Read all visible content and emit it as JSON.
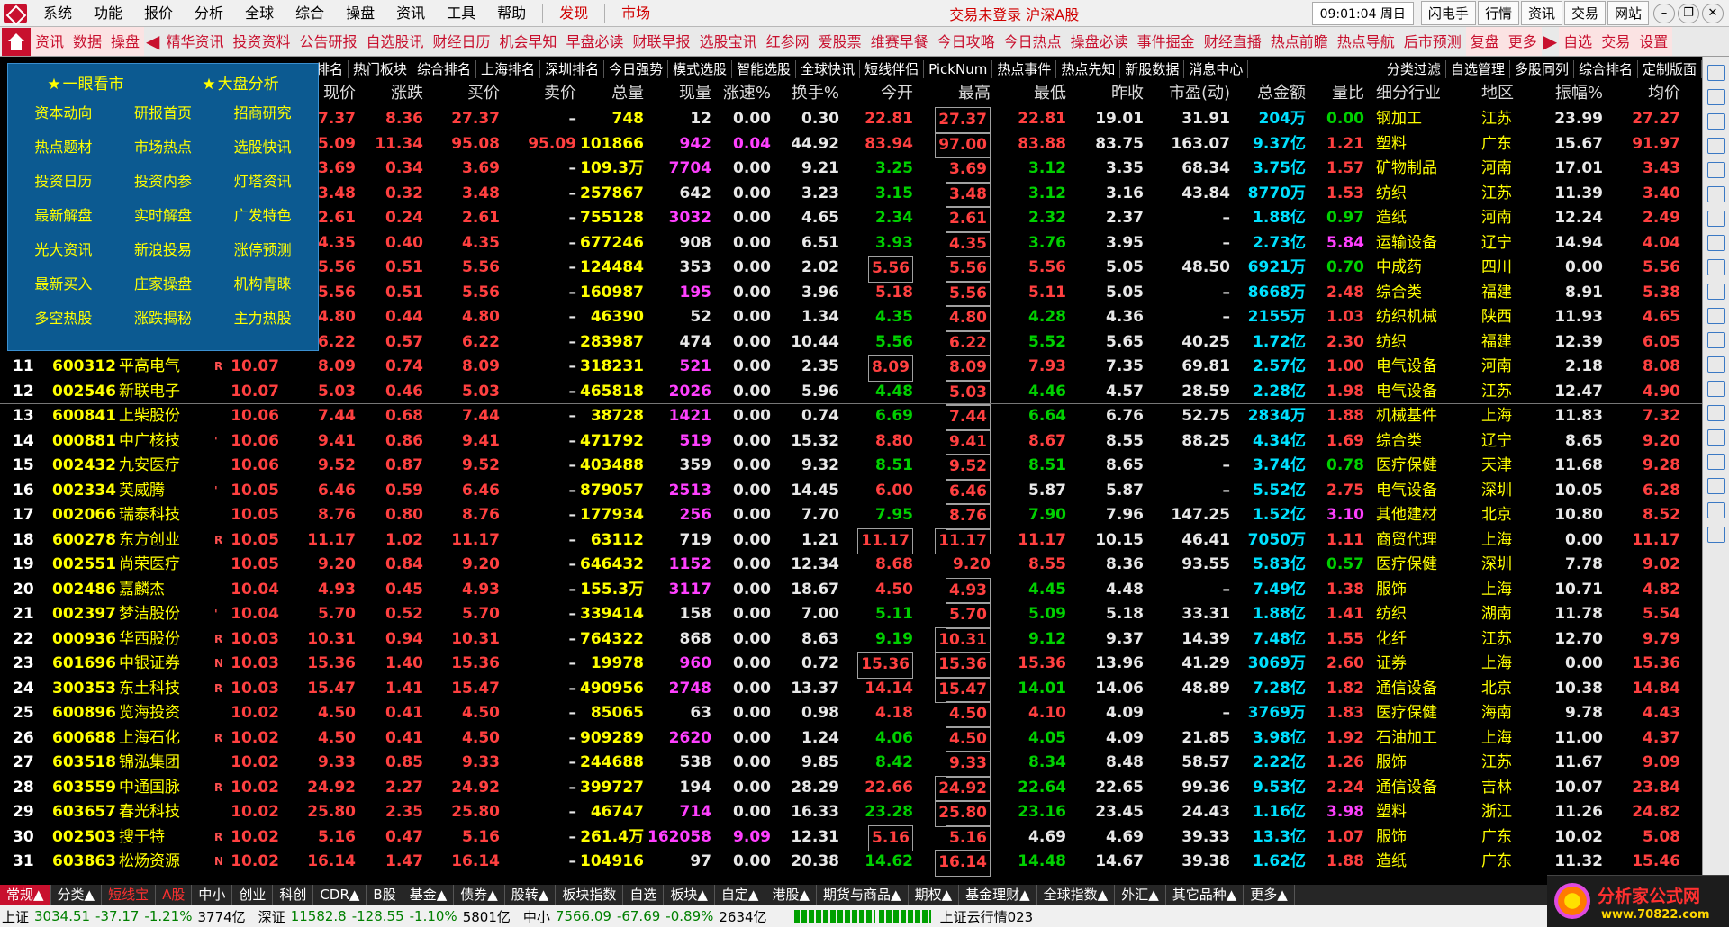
{
  "menu": [
    "系统",
    "功能",
    "报价",
    "分析",
    "全球",
    "综合",
    "操盘",
    "资讯",
    "工具",
    "帮助"
  ],
  "menu_red": [
    "发现",
    "市场"
  ],
  "status_text": "交易未登录 沪深A股",
  "clock": "09:01:04 周日",
  "right_buttons": [
    "闪电手",
    "行情",
    "资讯",
    "交易",
    "网站"
  ],
  "toolbar": [
    "资讯",
    "数据",
    "操盘",
    "精华资讯",
    "投资资料",
    "公告研报",
    "自选股讯",
    "财经日历",
    "机会早知",
    "早盘必读",
    "财联早报",
    "选股宝讯",
    "红参网",
    "爱股票",
    "维赛早餐",
    "今日攻略",
    "今日热点",
    "操盘必读",
    "事件掘金",
    "财经直播",
    "热点前瞻",
    "热点导航",
    "后市预测",
    "复盘",
    "更多",
    "自选",
    "交易",
    "设置"
  ],
  "float_menu": {
    "head": [
      "一眼看市",
      "大盘分析"
    ],
    "items": [
      "资本动向",
      "研报首页",
      "招商研究",
      "热点题材",
      "市场热点",
      "选股快讯",
      "投资日历",
      "投资内参",
      "灯塔资讯",
      "最新解盘",
      "实时解盘",
      "广发特色",
      "光大资讯",
      "新浪投易",
      "涨停预测",
      "最新买入",
      "庄家操盘",
      "机构青睐",
      "多空热股",
      "涨跌揭秘",
      "主力热股"
    ]
  },
  "column_tabs": [
    "排名",
    "热门板块",
    "综合排名",
    "上海排名",
    "深圳排名",
    "今日强势",
    "模式选股",
    "智能选股",
    "全球快讯",
    "短线伴侣",
    "PickNum",
    "热点事件",
    "热点先知",
    "新股数据",
    "消息中心",
    "分类过滤",
    "自选管理",
    "多股同列",
    "综合排名",
    "定制版面"
  ],
  "headers": [
    "现价",
    "涨跌",
    "买价",
    "卖价",
    "总量",
    "现量",
    "涨速%",
    "换手%",
    "今开",
    "最高",
    "最低",
    "昨收",
    "市盈(动)",
    "总金额",
    "量比",
    "细分行业",
    "地区",
    "振幅%",
    "均价"
  ],
  "rows": [
    {
      "no": "",
      "code": "",
      "name": "",
      "flag": "",
      "zf": "",
      "p": "27.37",
      "chg": "8.36",
      "buy": "27.37",
      "sell": "–",
      "vol": "748",
      "cur": "12",
      "spd": "0.00",
      "to": "0.30",
      "op": "22.81",
      "hi": "27.37",
      "lo": "22.81",
      "pc": "19.01",
      "pe": "31.91",
      "amt": "204万",
      "lb": "0.00",
      "ind": "钢加工",
      "reg": "江苏",
      "amp": "23.99",
      "avg": "27.27"
    },
    {
      "no": "",
      "code": "",
      "name": "",
      "flag": "",
      "zf": "",
      "p": "95.09",
      "chg": "11.34",
      "buy": "95.08",
      "sell": "95.09",
      "vol": "101866",
      "cur": "942",
      "spd": "0.04",
      "to": "44.92",
      "op": "83.94",
      "hi": "97.00",
      "lo": "83.88",
      "pc": "83.75",
      "pe": "163.07",
      "amt": "9.37亿",
      "lb": "1.21",
      "ind": "塑料",
      "reg": "广东",
      "amp": "15.67",
      "avg": "91.97"
    },
    {
      "no": "",
      "code": "",
      "name": "",
      "flag": "",
      "zf": "",
      "p": "3.69",
      "chg": "0.34",
      "buy": "3.69",
      "sell": "–",
      "vol": "109.3万",
      "cur": "7704",
      "spd": "0.00",
      "to": "9.21",
      "op": "3.25",
      "hi": "3.69",
      "lo": "3.12",
      "pc": "3.35",
      "pe": "68.34",
      "amt": "3.75亿",
      "lb": "1.57",
      "ind": "矿物制品",
      "reg": "河南",
      "amp": "17.01",
      "avg": "3.43"
    },
    {
      "no": "",
      "code": "",
      "name": "",
      "flag": "",
      "zf": "",
      "p": "3.48",
      "chg": "0.32",
      "buy": "3.48",
      "sell": "–",
      "vol": "257867",
      "cur": "642",
      "spd": "0.00",
      "to": "3.23",
      "op": "3.15",
      "hi": "3.48",
      "lo": "3.12",
      "pc": "3.16",
      "pe": "43.84",
      "amt": "8770万",
      "lb": "1.53",
      "ind": "纺织",
      "reg": "江苏",
      "amp": "11.39",
      "avg": "3.40"
    },
    {
      "no": "",
      "code": "",
      "name": "",
      "flag": "",
      "zf": "",
      "p": "2.61",
      "chg": "0.24",
      "buy": "2.61",
      "sell": "–",
      "vol": "755128",
      "cur": "3032",
      "spd": "0.00",
      "to": "4.65",
      "op": "2.34",
      "hi": "2.61",
      "lo": "2.32",
      "pc": "2.37",
      "pe": "–",
      "amt": "1.88亿",
      "lb": "0.97",
      "ind": "造纸",
      "reg": "河南",
      "amp": "12.24",
      "avg": "2.49"
    },
    {
      "no": "",
      "code": "",
      "name": "",
      "flag": "",
      "zf": "",
      "p": "4.35",
      "chg": "0.40",
      "buy": "4.35",
      "sell": "–",
      "vol": "677246",
      "cur": "908",
      "spd": "0.00",
      "to": "6.51",
      "op": "3.93",
      "hi": "4.35",
      "lo": "3.76",
      "pc": "3.95",
      "pe": "–",
      "amt": "2.73亿",
      "lb": "5.84",
      "ind": "运输设备",
      "reg": "辽宁",
      "amp": "14.94",
      "avg": "4.04"
    },
    {
      "no": "",
      "code": "",
      "name": "",
      "flag": "",
      "zf": "",
      "p": "5.56",
      "chg": "0.51",
      "buy": "5.56",
      "sell": "–",
      "vol": "124484",
      "cur": "353",
      "spd": "0.00",
      "to": "2.02",
      "op": "5.56",
      "hi": "5.56",
      "lo": "5.56",
      "pc": "5.05",
      "pe": "48.50",
      "amt": "6921万",
      "lb": "0.70",
      "ind": "中成药",
      "reg": "四川",
      "amp": "0.00",
      "avg": "5.56"
    },
    {
      "no": "",
      "code": "",
      "name": "",
      "flag": "",
      "zf": "",
      "p": "5.56",
      "chg": "0.51",
      "buy": "5.56",
      "sell": "–",
      "vol": "160987",
      "cur": "195",
      "spd": "0.00",
      "to": "3.96",
      "op": "5.18",
      "hi": "5.56",
      "lo": "5.11",
      "pc": "5.05",
      "pe": "–",
      "amt": "8668万",
      "lb": "2.48",
      "ind": "综合类",
      "reg": "福建",
      "amp": "8.91",
      "avg": "5.38"
    },
    {
      "no": "",
      "code": "",
      "name": "",
      "flag": "",
      "zf": "",
      "p": "4.80",
      "chg": "0.44",
      "buy": "4.80",
      "sell": "–",
      "vol": "46390",
      "cur": "52",
      "spd": "0.00",
      "to": "1.34",
      "op": "4.35",
      "hi": "4.80",
      "lo": "4.28",
      "pc": "4.36",
      "pe": "–",
      "amt": "2155万",
      "lb": "1.03",
      "ind": "纺织机械",
      "reg": "陕西",
      "amp": "11.93",
      "avg": "4.65"
    },
    {
      "no": "",
      "code": "",
      "name": "",
      "flag": "",
      "zf": "",
      "p": "6.22",
      "chg": "0.57",
      "buy": "6.22",
      "sell": "–",
      "vol": "283987",
      "cur": "474",
      "spd": "0.00",
      "to": "10.44",
      "op": "5.56",
      "hi": "6.22",
      "lo": "5.52",
      "pc": "5.65",
      "pe": "40.25",
      "amt": "1.72亿",
      "lb": "2.30",
      "ind": "纺织",
      "reg": "福建",
      "amp": "12.39",
      "avg": "6.05"
    },
    {
      "no": "11",
      "code": "600312",
      "name": "平高电气",
      "flag": "R",
      "zf": "10.07",
      "p": "8.09",
      "chg": "0.74",
      "buy": "8.09",
      "sell": "–",
      "vol": "318231",
      "cur": "521",
      "spd": "0.00",
      "to": "2.35",
      "op": "8.09",
      "hi": "8.09",
      "lo": "7.93",
      "pc": "7.35",
      "pe": "69.81",
      "amt": "2.57亿",
      "lb": "1.00",
      "ind": "电气设备",
      "reg": "河南",
      "amp": "2.18",
      "avg": "8.08"
    },
    {
      "no": "12",
      "code": "002546",
      "name": "新联电子",
      "flag": "",
      "zf": "10.07",
      "p": "5.03",
      "chg": "0.46",
      "buy": "5.03",
      "sell": "–",
      "vol": "465818",
      "cur": "2026",
      "spd": "0.00",
      "to": "5.96",
      "op": "4.48",
      "hi": "5.03",
      "lo": "4.46",
      "pc": "4.57",
      "pe": "28.59",
      "amt": "2.28亿",
      "lb": "1.98",
      "ind": "电气设备",
      "reg": "江苏",
      "amp": "12.47",
      "avg": "4.90"
    },
    {
      "no": "13",
      "code": "600841",
      "name": "上柴股份",
      "flag": "",
      "zf": "10.06",
      "p": "7.44",
      "chg": "0.68",
      "buy": "7.44",
      "sell": "–",
      "vol": "38728",
      "cur": "1421",
      "spd": "0.00",
      "to": "0.74",
      "op": "6.69",
      "hi": "7.44",
      "lo": "6.64",
      "pc": "6.76",
      "pe": "52.75",
      "amt": "2834万",
      "lb": "1.88",
      "ind": "机械基件",
      "reg": "上海",
      "amp": "11.83",
      "avg": "7.32"
    },
    {
      "no": "14",
      "code": "000881",
      "name": "中广核技",
      "flag": "'",
      "zf": "10.06",
      "p": "9.41",
      "chg": "0.86",
      "buy": "9.41",
      "sell": "–",
      "vol": "471792",
      "cur": "519",
      "spd": "0.00",
      "to": "15.32",
      "op": "8.80",
      "hi": "9.41",
      "lo": "8.67",
      "pc": "8.55",
      "pe": "88.25",
      "amt": "4.34亿",
      "lb": "1.69",
      "ind": "综合类",
      "reg": "辽宁",
      "amp": "8.65",
      "avg": "9.20"
    },
    {
      "no": "15",
      "code": "002432",
      "name": "九安医疗",
      "flag": "",
      "zf": "10.06",
      "p": "9.52",
      "chg": "0.87",
      "buy": "9.52",
      "sell": "–",
      "vol": "403488",
      "cur": "359",
      "spd": "0.00",
      "to": "9.32",
      "op": "8.51",
      "hi": "9.52",
      "lo": "8.51",
      "pc": "8.65",
      "pe": "–",
      "amt": "3.74亿",
      "lb": "0.78",
      "ind": "医疗保健",
      "reg": "天津",
      "amp": "11.68",
      "avg": "9.28"
    },
    {
      "no": "16",
      "code": "002334",
      "name": "英威腾",
      "flag": "'",
      "zf": "10.05",
      "p": "6.46",
      "chg": "0.59",
      "buy": "6.46",
      "sell": "–",
      "vol": "879057",
      "cur": "2513",
      "spd": "0.00",
      "to": "14.45",
      "op": "6.00",
      "hi": "6.46",
      "lo": "5.87",
      "pc": "5.87",
      "pe": "–",
      "amt": "5.52亿",
      "lb": "2.75",
      "ind": "电气设备",
      "reg": "深圳",
      "amp": "10.05",
      "avg": "6.28"
    },
    {
      "no": "17",
      "code": "002066",
      "name": "瑞泰科技",
      "flag": "",
      "zf": "10.05",
      "p": "8.76",
      "chg": "0.80",
      "buy": "8.76",
      "sell": "–",
      "vol": "177934",
      "cur": "256",
      "spd": "0.00",
      "to": "7.70",
      "op": "7.95",
      "hi": "8.76",
      "lo": "7.90",
      "pc": "7.96",
      "pe": "147.25",
      "amt": "1.52亿",
      "lb": "3.10",
      "ind": "其他建材",
      "reg": "北京",
      "amp": "10.80",
      "avg": "8.52"
    },
    {
      "no": "18",
      "code": "600278",
      "name": "东方创业",
      "flag": "R",
      "zf": "10.05",
      "p": "11.17",
      "chg": "1.02",
      "buy": "11.17",
      "sell": "–",
      "vol": "63112",
      "cur": "719",
      "spd": "0.00",
      "to": "1.21",
      "op": "11.17",
      "hi": "11.17",
      "lo": "11.17",
      "pc": "10.15",
      "pe": "46.41",
      "amt": "7050万",
      "lb": "1.11",
      "ind": "商贸代理",
      "reg": "上海",
      "amp": "0.00",
      "avg": "11.17"
    },
    {
      "no": "19",
      "code": "002551",
      "name": "尚荣医疗",
      "flag": "",
      "zf": "10.05",
      "p": "9.20",
      "chg": "0.84",
      "buy": "9.20",
      "sell": "–",
      "vol": "646432",
      "cur": "1152",
      "spd": "0.00",
      "to": "12.34",
      "op": "8.68",
      "hi": "9.20",
      "lo": "8.55",
      "pc": "8.36",
      "pe": "93.55",
      "amt": "5.83亿",
      "lb": "0.57",
      "ind": "医疗保健",
      "reg": "深圳",
      "amp": "7.78",
      "avg": "9.02"
    },
    {
      "no": "20",
      "code": "002486",
      "name": "嘉麟杰",
      "flag": "",
      "zf": "10.04",
      "p": "4.93",
      "chg": "0.45",
      "buy": "4.93",
      "sell": "–",
      "vol": "155.3万",
      "cur": "3117",
      "spd": "0.00",
      "to": "18.67",
      "op": "4.50",
      "hi": "4.93",
      "lo": "4.45",
      "pc": "4.48",
      "pe": "–",
      "amt": "7.49亿",
      "lb": "1.38",
      "ind": "服饰",
      "reg": "上海",
      "amp": "10.71",
      "avg": "4.82"
    },
    {
      "no": "21",
      "code": "002397",
      "name": "梦洁股份",
      "flag": "'",
      "zf": "10.04",
      "p": "5.70",
      "chg": "0.52",
      "buy": "5.70",
      "sell": "–",
      "vol": "339414",
      "cur": "158",
      "spd": "0.00",
      "to": "7.00",
      "op": "5.11",
      "hi": "5.70",
      "lo": "5.09",
      "pc": "5.18",
      "pe": "33.31",
      "amt": "1.88亿",
      "lb": "1.41",
      "ind": "纺织",
      "reg": "湖南",
      "amp": "11.78",
      "avg": "5.54"
    },
    {
      "no": "22",
      "code": "000936",
      "name": "华西股份",
      "flag": "R",
      "zf": "10.03",
      "p": "10.31",
      "chg": "0.94",
      "buy": "10.31",
      "sell": "–",
      "vol": "764322",
      "cur": "868",
      "spd": "0.00",
      "to": "8.63",
      "op": "9.19",
      "hi": "10.31",
      "lo": "9.12",
      "pc": "9.37",
      "pe": "14.39",
      "amt": "7.48亿",
      "lb": "1.55",
      "ind": "化纤",
      "reg": "江苏",
      "amp": "12.70",
      "avg": "9.79"
    },
    {
      "no": "23",
      "code": "601696",
      "name": "中银证券",
      "flag": "N",
      "zf": "10.03",
      "p": "15.36",
      "chg": "1.40",
      "buy": "15.36",
      "sell": "–",
      "vol": "19978",
      "cur": "960",
      "spd": "0.00",
      "to": "0.72",
      "op": "15.36",
      "hi": "15.36",
      "lo": "15.36",
      "pc": "13.96",
      "pe": "41.29",
      "amt": "3069万",
      "lb": "2.60",
      "ind": "证券",
      "reg": "上海",
      "amp": "0.00",
      "avg": "15.36"
    },
    {
      "no": "24",
      "code": "300353",
      "name": "东土科技",
      "flag": "R",
      "zf": "10.03",
      "p": "15.47",
      "chg": "1.41",
      "buy": "15.47",
      "sell": "–",
      "vol": "490956",
      "cur": "2748",
      "spd": "0.00",
      "to": "13.37",
      "op": "14.14",
      "hi": "15.47",
      "lo": "14.01",
      "pc": "14.06",
      "pe": "48.89",
      "amt": "7.28亿",
      "lb": "1.82",
      "ind": "通信设备",
      "reg": "北京",
      "amp": "10.38",
      "avg": "14.84"
    },
    {
      "no": "25",
      "code": "600896",
      "name": "览海投资",
      "flag": "",
      "zf": "10.02",
      "p": "4.50",
      "chg": "0.41",
      "buy": "4.50",
      "sell": "–",
      "vol": "85065",
      "cur": "63",
      "spd": "0.00",
      "to": "0.98",
      "op": "4.18",
      "hi": "4.50",
      "lo": "4.10",
      "pc": "4.09",
      "pe": "–",
      "amt": "3769万",
      "lb": "1.83",
      "ind": "医疗保健",
      "reg": "海南",
      "amp": "9.78",
      "avg": "4.43"
    },
    {
      "no": "26",
      "code": "600688",
      "name": "上海石化",
      "flag": "R",
      "zf": "10.02",
      "p": "4.50",
      "chg": "0.41",
      "buy": "4.50",
      "sell": "–",
      "vol": "909289",
      "cur": "2620",
      "spd": "0.00",
      "to": "1.24",
      "op": "4.06",
      "hi": "4.50",
      "lo": "4.05",
      "pc": "4.09",
      "pe": "21.85",
      "amt": "3.98亿",
      "lb": "1.92",
      "ind": "石油加工",
      "reg": "上海",
      "amp": "11.00",
      "avg": "4.37"
    },
    {
      "no": "27",
      "code": "603518",
      "name": "锦泓集团",
      "flag": "",
      "zf": "10.02",
      "p": "9.33",
      "chg": "0.85",
      "buy": "9.33",
      "sell": "–",
      "vol": "244688",
      "cur": "538",
      "spd": "0.00",
      "to": "9.85",
      "op": "8.42",
      "hi": "9.33",
      "lo": "8.34",
      "pc": "8.48",
      "pe": "58.57",
      "amt": "2.22亿",
      "lb": "1.26",
      "ind": "服饰",
      "reg": "江苏",
      "amp": "11.67",
      "avg": "9.09"
    },
    {
      "no": "28",
      "code": "603559",
      "name": "中通国脉",
      "flag": "R",
      "zf": "10.02",
      "p": "24.92",
      "chg": "2.27",
      "buy": "24.92",
      "sell": "–",
      "vol": "399727",
      "cur": "194",
      "spd": "0.00",
      "to": "28.29",
      "op": "22.66",
      "hi": "24.92",
      "lo": "22.64",
      "pc": "22.65",
      "pe": "99.36",
      "amt": "9.53亿",
      "lb": "2.24",
      "ind": "通信设备",
      "reg": "吉林",
      "amp": "10.07",
      "avg": "23.84"
    },
    {
      "no": "29",
      "code": "603657",
      "name": "春光科技",
      "flag": "",
      "zf": "10.02",
      "p": "25.80",
      "chg": "2.35",
      "buy": "25.80",
      "sell": "–",
      "vol": "46747",
      "cur": "714",
      "spd": "0.00",
      "to": "16.33",
      "op": "23.28",
      "hi": "25.80",
      "lo": "23.16",
      "pc": "23.45",
      "pe": "24.43",
      "amt": "1.16亿",
      "lb": "3.98",
      "ind": "塑料",
      "reg": "浙江",
      "amp": "11.26",
      "avg": "24.82"
    },
    {
      "no": "30",
      "code": "002503",
      "name": "搜于特",
      "flag": "R",
      "zf": "10.02",
      "p": "5.16",
      "chg": "0.47",
      "buy": "5.16",
      "sell": "–",
      "vol": "261.4万",
      "cur": "162058",
      "spd": "9.09",
      "to": "12.31",
      "op": "5.16",
      "hi": "5.16",
      "lo": "4.69",
      "pc": "4.69",
      "pe": "39.33",
      "amt": "13.3亿",
      "lb": "1.07",
      "ind": "服饰",
      "reg": "广东",
      "amp": "10.02",
      "avg": "5.08"
    },
    {
      "no": "31",
      "code": "603863",
      "name": "松炀资源",
      "flag": "N",
      "zf": "10.02",
      "p": "16.14",
      "chg": "1.47",
      "buy": "16.14",
      "sell": "–",
      "vol": "104916",
      "cur": "97",
      "spd": "0.00",
      "to": "20.38",
      "op": "14.62",
      "hi": "16.14",
      "lo": "14.48",
      "pc": "14.67",
      "pe": "39.38",
      "amt": "1.62亿",
      "lb": "1.88",
      "ind": "造纸",
      "reg": "广东",
      "amp": "11.32",
      "avg": "15.46"
    }
  ],
  "tabs": [
    "常规▲",
    "分类▲",
    "短线宝",
    "A股",
    "中小",
    "创业",
    "科创",
    "CDR▲",
    "B股",
    "基金▲",
    "债券▲",
    "股转▲",
    "板块指数",
    "自选",
    "板块▲",
    "自定▲",
    "港股▲",
    "期货与商品▲",
    "期权▲",
    "基金理财▲",
    "全球指数▲",
    "外汇▲",
    "其它品种▲",
    "更多▲"
  ],
  "status": {
    "sh_label": "上证",
    "sh_val": "3034.51",
    "sh_chg": "-37.17",
    "sh_pct": "-1.21%",
    "sh_amt": "3774亿",
    "sz_label": "深证",
    "sz_val": "11582.8",
    "sz_chg": "-128.55",
    "sz_pct": "-1.10%",
    "sz_amt": "5801亿",
    "zx_label": "中小",
    "zx_val": "7566.09",
    "zx_chg": "-67.69",
    "zx_pct": "-0.89%",
    "zx_amt": "2634亿",
    "cloud": "上证云行情023"
  },
  "brand": {
    "name": "分析家公式网",
    "url": "www.70822.com"
  }
}
